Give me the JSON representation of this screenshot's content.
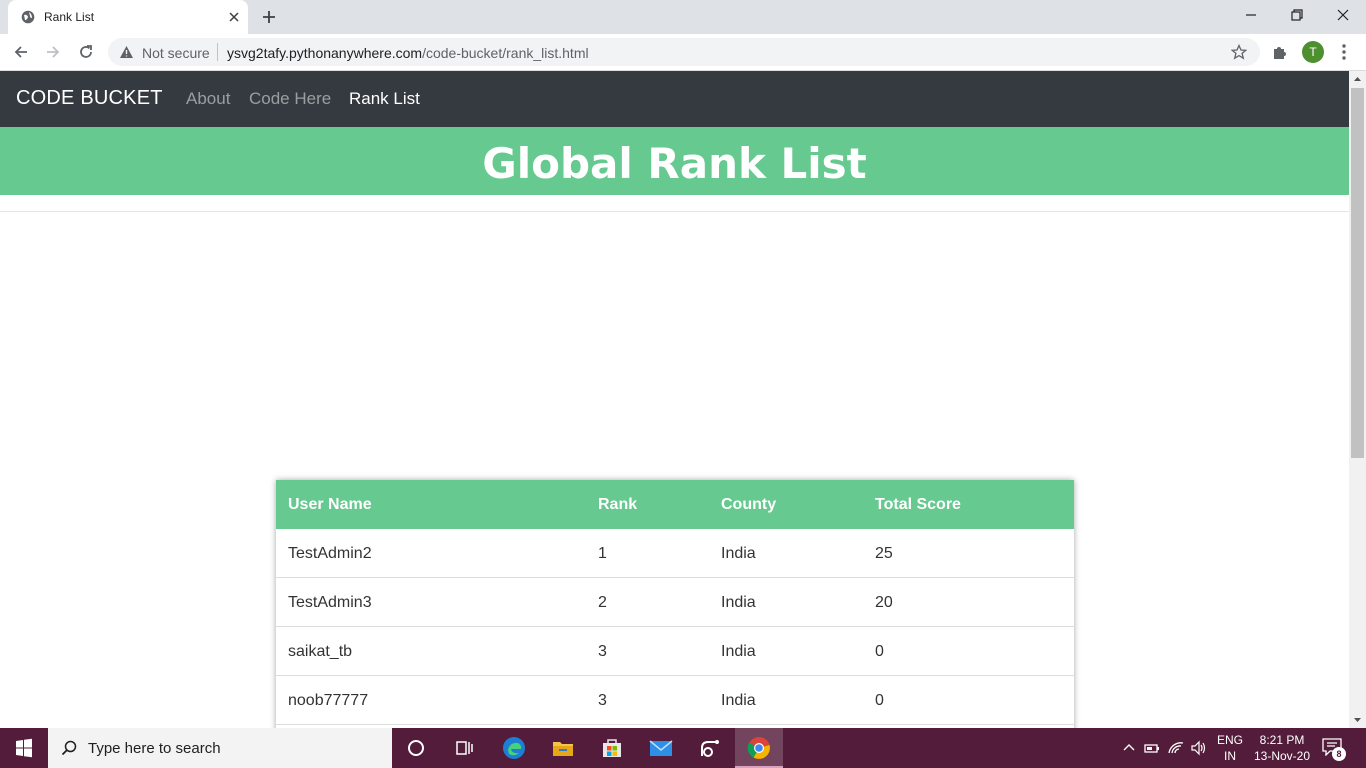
{
  "browser": {
    "tab": {
      "title": "Rank List"
    },
    "address": {
      "security": "Not secure",
      "url_host": "ysvg2tafy.pythonanywhere.com",
      "url_path": "/code-bucket/rank_list.html"
    },
    "profile_initial": "T"
  },
  "navbar": {
    "brand": "CODE BUCKET",
    "links": [
      {
        "label": "About",
        "active": false
      },
      {
        "label": "Code Here",
        "active": false
      },
      {
        "label": "Rank List",
        "active": true
      }
    ]
  },
  "hero": {
    "title": "Global Rank List"
  },
  "rank_table": {
    "headers": [
      "User Name",
      "Rank",
      "County",
      "Total Score"
    ],
    "rows": [
      [
        "TestAdmin2",
        "1",
        "India",
        "25"
      ],
      [
        "TestAdmin3",
        "2",
        "India",
        "20"
      ],
      [
        "saikat_tb",
        "3",
        "India",
        "0"
      ],
      [
        "noob77777",
        "3",
        "India",
        "0"
      ]
    ]
  },
  "taskbar": {
    "search_placeholder": "Type here to search",
    "lang_line1": "ENG",
    "lang_line2": "IN",
    "time": "8:21 PM",
    "date": "13-Nov-20",
    "notification_count": "8"
  },
  "colors": {
    "navbar_bg": "#343a40",
    "accent_green": "#66c990",
    "taskbar_bg": "#531c3a"
  }
}
